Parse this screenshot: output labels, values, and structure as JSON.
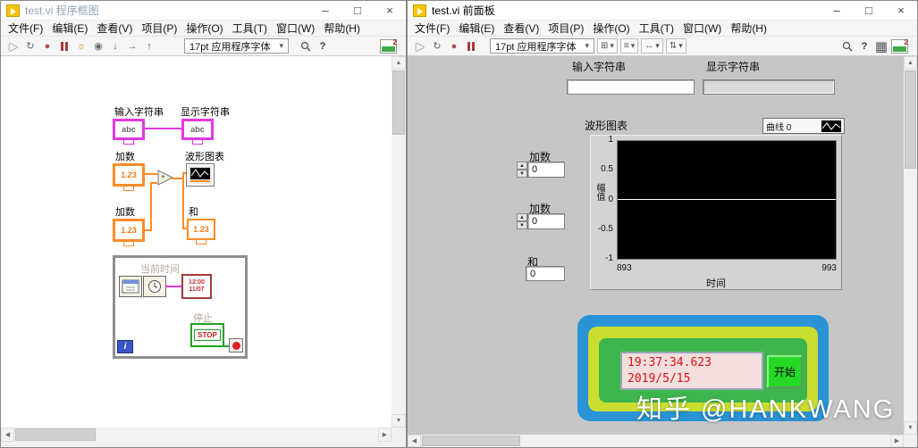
{
  "menu": [
    "文件(F)",
    "编辑(E)",
    "查看(V)",
    "项目(P)",
    "操作(O)",
    "工具(T)",
    "窗口(W)",
    "帮助(H)"
  ],
  "icons": {
    "run": "▶",
    "run_continuous": "↻",
    "abort": "●",
    "highlight_execution": "☼",
    "retain_wire_values": "◉",
    "step_into": "↓",
    "step_over": "→",
    "step_out": "↑",
    "dropdown": "▾",
    "help": "?",
    "align_objects": "⊞",
    "distribute_objects": "≡",
    "resize_objects": "↔",
    "reorder_objects": "⇅",
    "grid": "▦",
    "scroll_up": "▲",
    "scroll_down": "▼",
    "scroll_left": "◀",
    "scroll_right": "▶",
    "minimize": "–",
    "maximize": "□",
    "close": "×",
    "add_function": "+"
  },
  "left_window": {
    "title": "test.vi 程序框图",
    "toolbar": {
      "font_selector": "17pt 应用程序字体",
      "badge": "2"
    },
    "diagram": {
      "input_string": {
        "label": "输入字符串",
        "glyph": "abc"
      },
      "display_string": {
        "label": "显示字符串",
        "glyph": "abc"
      },
      "addend1": {
        "label": "加数",
        "glyph": "1.23"
      },
      "addend2": {
        "label": "加数",
        "glyph": "1.23"
      },
      "waveform_chart": {
        "label": "波形图表"
      },
      "sum": {
        "label": "和",
        "glyph": "1.23"
      },
      "while_loop": {
        "current_time_label": "当前时间",
        "clock_time": "12:00",
        "clock_date": "11/07",
        "stop_label": "停止",
        "stop_glyph": "STOP",
        "iteration_glyph": "i"
      }
    }
  },
  "right_window": {
    "title": "test.vi 前面板",
    "toolbar": {
      "font_selector": "17pt 应用程序字体",
      "badge": "2"
    },
    "panel": {
      "input_string": {
        "label": "输入字符串",
        "value": ""
      },
      "display_string": {
        "label": "显示字符串",
        "value": ""
      },
      "addend1": {
        "label": "加数",
        "value": "0"
      },
      "addend2": {
        "label": "加数",
        "value": "0"
      },
      "sum": {
        "label": "和",
        "value": "0"
      },
      "clock": {
        "time": "19:37:34.623",
        "date": "2019/5/15"
      },
      "start_button_label": "开始"
    }
  },
  "chart_data": {
    "type": "line",
    "title": "波形图表",
    "legend_entries": [
      "曲线 0"
    ],
    "ylabel": "幅值",
    "xlabel": "时间",
    "ylim": [
      -1,
      1
    ],
    "xlim": [
      893,
      993
    ],
    "y_ticks": [
      "1",
      "0.5",
      "0",
      "-0.5",
      "-1"
    ],
    "x_ticks": [
      "893",
      "993"
    ],
    "series": []
  },
  "watermark": "知乎 @HANKWANG"
}
